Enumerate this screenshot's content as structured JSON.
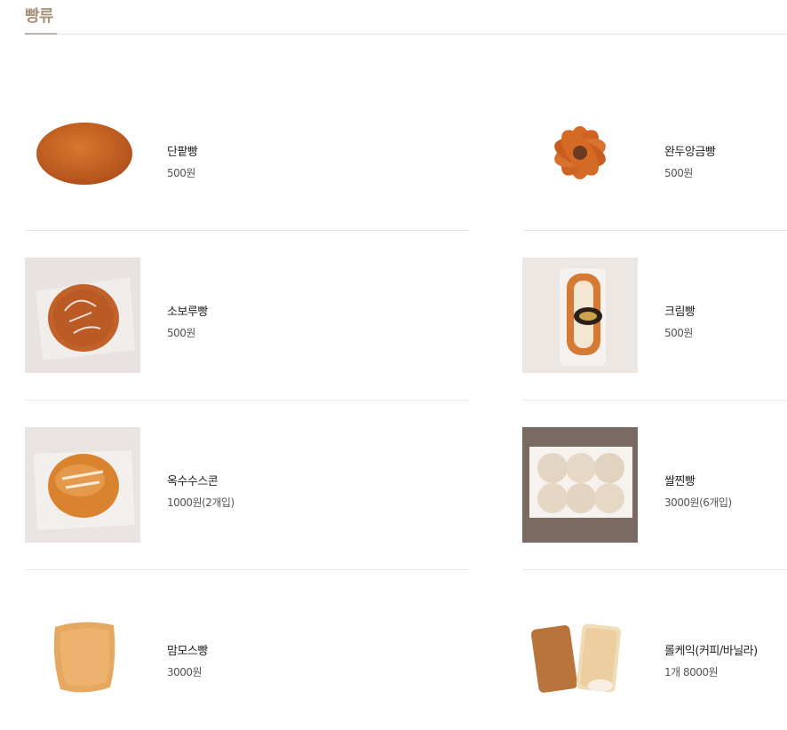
{
  "section": {
    "title": "빵류"
  },
  "products": [
    {
      "name": "단팥빵",
      "price": "500원",
      "image": "round-bun"
    },
    {
      "name": "완두앙금빵",
      "price": "500원",
      "image": "flower-bun"
    },
    {
      "name": "소보루빵",
      "price": "500원",
      "image": "soboro-bag"
    },
    {
      "name": "크림빵",
      "price": "500원",
      "image": "cream-bag"
    },
    {
      "name": "옥수수스콘",
      "price": "1000원(2개입)",
      "image": "scone-bag"
    },
    {
      "name": "쌀찐빵",
      "price": "3000원(6개입)",
      "image": "steamed-tray"
    },
    {
      "name": "맘모스빵",
      "price": "3000원",
      "image": "mammoth-bread"
    },
    {
      "name": "롤케익(커피/바닐라)",
      "price": "1개 8000원",
      "image": "roll-cake"
    }
  ],
  "colors": {
    "title": "#a7937c",
    "divider": "#e8e8e8"
  }
}
